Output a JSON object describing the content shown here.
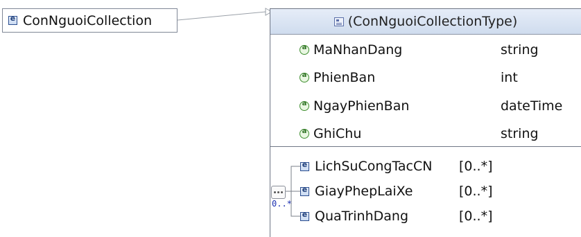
{
  "root_element": {
    "label": "ConNguoiCollection"
  },
  "type": {
    "header": "(ConNguoiCollectionType)",
    "attributes": [
      {
        "name": "MaNhanDang",
        "type": "string"
      },
      {
        "name": "PhienBan",
        "type": "int"
      },
      {
        "name": "NgayPhienBan",
        "type": "dateTime"
      },
      {
        "name": "GhiChu",
        "type": "string"
      }
    ],
    "sequence": {
      "occurrence": "0..*",
      "children": [
        {
          "name": "LichSuCongTacCN",
          "occurrence": "[0..*]"
        },
        {
          "name": "GiayPhepLaiXe",
          "occurrence": "[0..*]"
        },
        {
          "name": "QuaTrinhDang",
          "occurrence": "[0..*]"
        }
      ]
    }
  },
  "colors": {
    "element_icon": "#2a4d8f",
    "attribute_icon": "#3e8e2e",
    "header_bg": "#d8e3f3",
    "occurrence_text": "#1a2fb0"
  }
}
